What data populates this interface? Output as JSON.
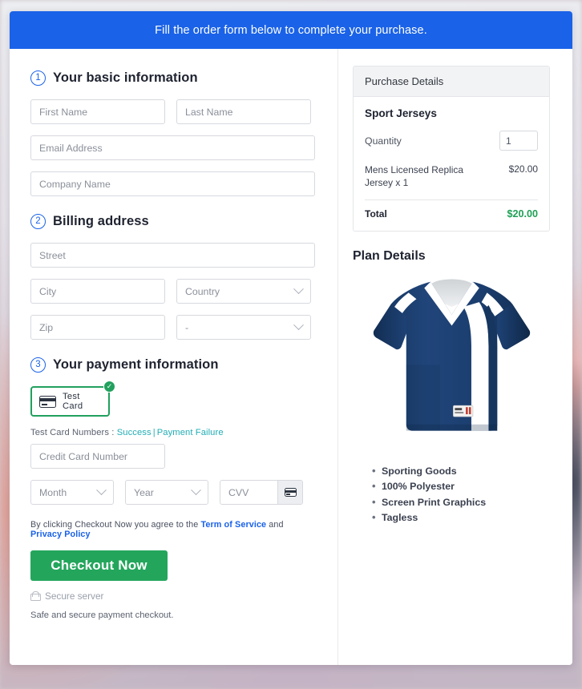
{
  "banner": {
    "text": "Fill the order form below to complete your purchase."
  },
  "sections": {
    "basic": {
      "number": "1",
      "title": "Your basic information",
      "fields": {
        "first_name": "First Name",
        "last_name": "Last Name",
        "email": "Email Address",
        "company": "Company Name"
      }
    },
    "billing": {
      "number": "2",
      "title": "Billing address",
      "fields": {
        "street": "Street",
        "city": "City",
        "country": "Country",
        "zip": "Zip",
        "state": "-"
      }
    },
    "payment": {
      "number": "3",
      "title": "Your payment information",
      "test_card_label": "Test Card",
      "check_icon": "check-icon",
      "card_icon": "credit-card-icon",
      "note_prefix": "Test Card Numbers : ",
      "note_success": "Success",
      "note_separator": "|",
      "note_failure": "Payment Failure",
      "fields": {
        "credit_card_number": "Credit Card Number",
        "month": "Month",
        "year": "Year",
        "cvv": "CVV"
      }
    }
  },
  "terms": {
    "prefix": "By clicking Checkout Now you agree to the ",
    "tos": "Term of Service",
    "middle": " and ",
    "privacy": "Privacy Policy"
  },
  "checkout": {
    "label": "Checkout Now"
  },
  "secure": {
    "icon": "lock-icon",
    "label": "Secure server",
    "note": "Safe and secure payment checkout."
  },
  "purchase": {
    "header": "Purchase Details",
    "product": "Sport Jerseys",
    "quantity_label": "Quantity",
    "quantity_value": "1",
    "line_item_name": "Mens Licensed Replica Jersey x 1",
    "line_item_price": "$20.00",
    "total_label": "Total",
    "total_value": "$20.00"
  },
  "plan": {
    "title": "Plan Details",
    "image_name": "navy-sport-jersey-image",
    "features": [
      "Sporting Goods",
      "100% Polyester",
      "Screen Print Graphics",
      "Tagless"
    ]
  },
  "colors": {
    "banner_blue": "#1a62e8",
    "accent_blue": "#1a62e8",
    "success_green": "#22a05e",
    "checkout_green": "#23a65c",
    "link_teal": "#21adb5",
    "total_green": "#1fa055",
    "jersey_navy": "#1d3f6e"
  }
}
